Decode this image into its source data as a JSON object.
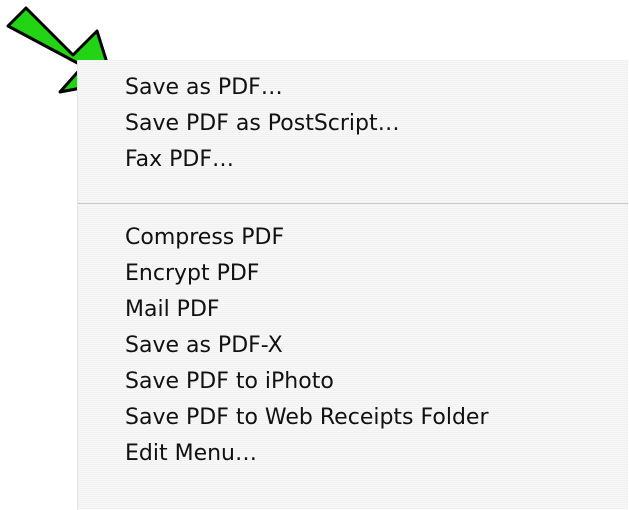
{
  "menu": {
    "group1": [
      "Save as PDF…",
      "Save PDF as PostScript…",
      "Fax PDF…"
    ],
    "group2": [
      "Compress PDF",
      "Encrypt PDF",
      "Mail PDF",
      "Save as PDF-X",
      "Save PDF to iPhoto",
      "Save PDF to Web Receipts Folder",
      "Edit Menu…"
    ]
  },
  "annotation": {
    "arrow_color": "#22d414",
    "arrow_outline": "#000000",
    "icon": "green-pointer-arrow"
  }
}
